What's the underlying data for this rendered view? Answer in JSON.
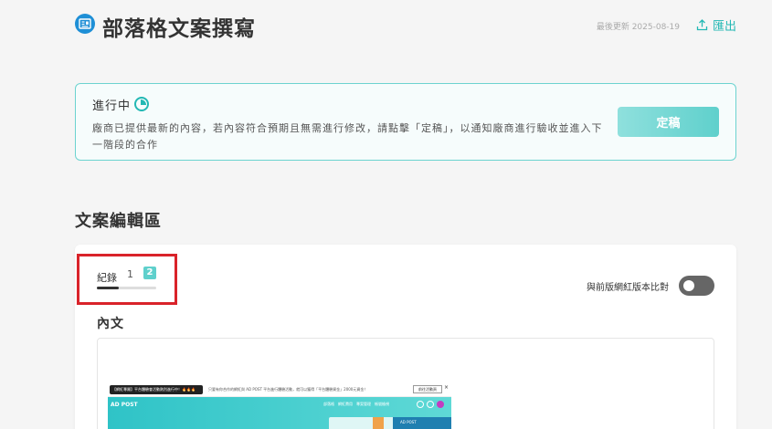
{
  "header": {
    "title": "部落格文案撰寫",
    "last_updated": "最後更新 2025-08-19",
    "export_label": "匯出"
  },
  "status_card": {
    "status": "進行中",
    "description": "廠商已提供最新的內容，若內容符合預期且無需進行修改，請點擊「定稿」，以通知廠商進行驗收並進入下一階段的合作",
    "finalize_label": "定稿"
  },
  "editor": {
    "section_title": "文案編輯區",
    "record_label": "紀錄",
    "versions": [
      "1",
      "2"
    ],
    "active_version": "2",
    "compare_label": "與前版網紅版本比對",
    "compare_enabled": false,
    "content_label": "內文"
  },
  "thumbnail": {
    "pill_text": "【網紅專屬】平台體驗會活動熱烈進行中！🔥🔥🔥",
    "banner_text": "只要有你合作的網紅與 AD POST 平台進行體驗活動，就可以獲得「平台體驗資金」2000元資金！",
    "banner_button": "前往活動頁",
    "close": "×",
    "logo": "AD POST",
    "nav": "部落格　網紅費用　專案管理　帳號檢視",
    "image_tag": "AD POST"
  },
  "colors": {
    "accent": "#23b8b4",
    "highlight_border": "#d9232a"
  }
}
